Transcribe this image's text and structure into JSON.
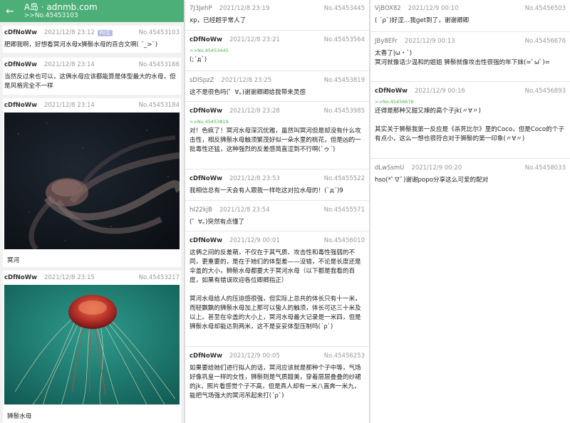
{
  "appbar": {
    "back_icon": "arrow-left-icon",
    "title": "A岛 · adnmb.com",
    "subtitle": ">>No.45453103"
  },
  "col1": {
    "posts": [
      {
        "uid": "cDfNoWw",
        "time": "2021/12/8 23:12",
        "badge": "Po主",
        "no": "No.45453103",
        "body": "肥卿我啊，好想看冥河水母x狮鬃水母的百合文啊( ´_>`)"
      },
      {
        "uid": "cDfNoWw",
        "time": "2021/12/8 23:14",
        "no": "No.45453166",
        "body": "当然反过来也可以，这俩水母应该都能算是体型最大的水母，但是风格完全不一样"
      },
      {
        "uid": "cDfNoWw",
        "time": "2021/12/8 23:14",
        "no": "No.45453184",
        "caption": "冥河"
      },
      {
        "uid": "cDfNoWw",
        "time": "2021/12/8 23:15",
        "no": "No.45453217",
        "caption": "狮鬃水母"
      }
    ]
  },
  "col2": {
    "posts": [
      {
        "uid": "7J3JehP",
        "time": "2021/12/8 23:19",
        "no": "No.45453445",
        "body": "xp，已经超乎常人了"
      },
      {
        "uid": "cDfNoWw",
        "time": "2021/12/8 23:21",
        "no": "No.45453564",
        "ref": ">>No.45453445",
        "body": "(;´д`)"
      },
      {
        "uid": "sDlSpzZ",
        "time": "2021/12/8 23:25",
        "no": "No.45453819",
        "body": "这不是很色吗(゜∀。)谢谢卿卿给我带来灵感"
      },
      {
        "uid": "cDfNoWw",
        "time": "2021/12/8 23:28",
        "no": "No.45453985",
        "ref": ">>No.45453819",
        "body": "对！色疯了！冥河水母深沉优雅，虽然叫冥河但是却没有什么攻击性，相反狮鬃水母触须繁茂好似一朵水里的桃花，但是凶的一批毒性还猛，这种强烈的反差感简直涩到不行啊(`ゥ´)"
      },
      {
        "uid": "cDfNoWw",
        "time": "2021/12/8 23:53",
        "no": "No.45455522",
        "body": "我相信总有一天会有人跟我一样吃这对拉水母的！(`д´)9"
      },
      {
        "uid": "hI22kjB",
        "time": "2021/12/8 23:54",
        "no": "No.45455571",
        "body": "(゜∀。)突然有点懂了"
      },
      {
        "uid": "cDfNoWw",
        "time": "2021/12/9 00:01",
        "no": "No.45456010",
        "body": "这俩之间的反差萌，不仅在于其气质、攻击性和毒性强弱的不同，更重要的，是在于她们的体型差——没错，不论是长度还是伞盖的大小，狮鬃水母都要大于冥河水母（以下都是我看的百度，如果有错误欢迎各位卿卿指正）\n\n冥河水母给人的压迫感很强，但实际上总共的体长只有十一米，而轻飘飘的狮鬃水母加上那可以蛰人的触须，体长可达三十米及以上。甚至在伞盖的大小上，冥河水母最大记录是一米四，但是狮鬃水母却能达到两米，这不是妥妥体型压制吗(´ρ`)"
      },
      {
        "uid": "cDfNoWw",
        "time": "2021/12/9 00:05",
        "no": "No.45456253",
        "body": "如果要给她们进行拟人的话，冥河应该就是那种个子中等，气场好像巩皇一样的女性，狮鬃则是气质甜美，穿着层层叠叠的纱裙的jk，照片看感觉个子不高，但是真人却有一米八直奔一米九，能把气场强大的冥河吊起来打(´ρ`)"
      }
    ]
  },
  "col3": {
    "posts": [
      {
        "uid": "VjBOX82",
        "time": "2021/12/9 00:10",
        "no": "No.45456503",
        "body": "( ´ρ`)好涩…我get到了，谢谢卿卿"
      },
      {
        "uid": "JBy8EFr",
        "time": "2021/12/9 00:13",
        "no": "No.45456676",
        "body": "太香了|ω・`)\n冥河就像话少温和的姐姐 狮鬃就像攻击性很强的年下妹(=ﾟωﾟ)="
      },
      {
        "uid": "cDfNoWw",
        "time": "2021/12/9 00:16",
        "no": "No.45456893",
        "ref": ">>No.45456676",
        "body": "还得是那种又甜又辣的高个子jk(〃∀〃)\n\n其实关于狮鬃我第一反应是《杀死比尔》里的Coco，但是Coco的个子有点小，这么一想也很符合对于狮鬃的第一印象(〃∀〃)"
      },
      {
        "uid": "dLwSsmU",
        "time": "2021/12/9 00:20",
        "no": "No.45458033",
        "body": "hso(*ﾟ∇ﾟ)谢谢popo分享这么可爱的配对"
      }
    ]
  }
}
